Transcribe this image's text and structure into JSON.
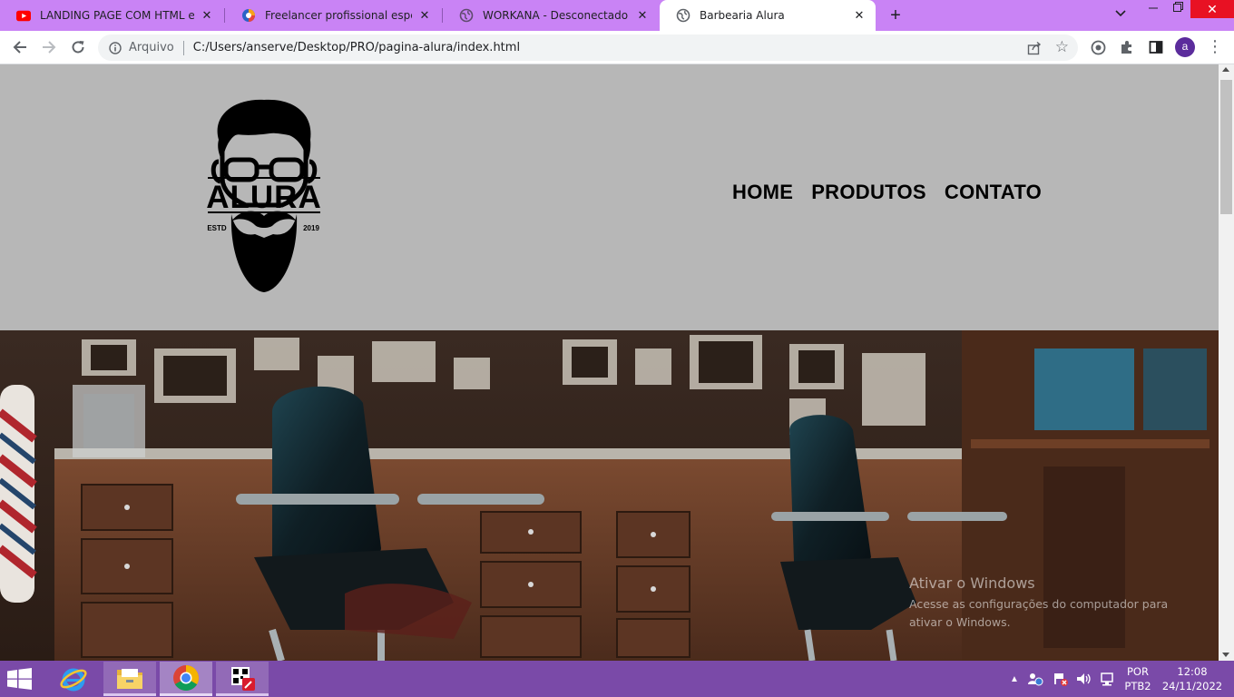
{
  "browser": {
    "tabs": [
      {
        "title": "LANDING PAGE COM HTML e CSS",
        "icon": "youtube-icon"
      },
      {
        "title": "Freelancer profissional especialista",
        "icon": "workana-icon"
      },
      {
        "title": "WORKANA - Desconectado",
        "icon": "globe-icon"
      },
      {
        "title": "Barbearia Alura",
        "icon": "globe-icon",
        "active": true
      }
    ],
    "address_scheme": "Arquivo",
    "address_url": "C:/Users/anserve/Desktop/PRO/pagina-alura/index.html",
    "profile_initial": "a",
    "accent_color": "#c983f5"
  },
  "site": {
    "header_bg": "#b7b7b7",
    "logo": {
      "brand": "ALURA",
      "left_tag": "ESTD",
      "right_tag": "2019"
    },
    "nav": [
      "HOME",
      "PRODUTOS",
      "CONTATO"
    ]
  },
  "watermark": {
    "line1": "Ativar o Windows",
    "line2": "Acesse as configurações do computador para ativar o Windows."
  },
  "taskbar": {
    "language": "POR",
    "layout": "PTB2",
    "time": "12:08",
    "date": "24/11/2022",
    "color": "#7a4aa8"
  }
}
